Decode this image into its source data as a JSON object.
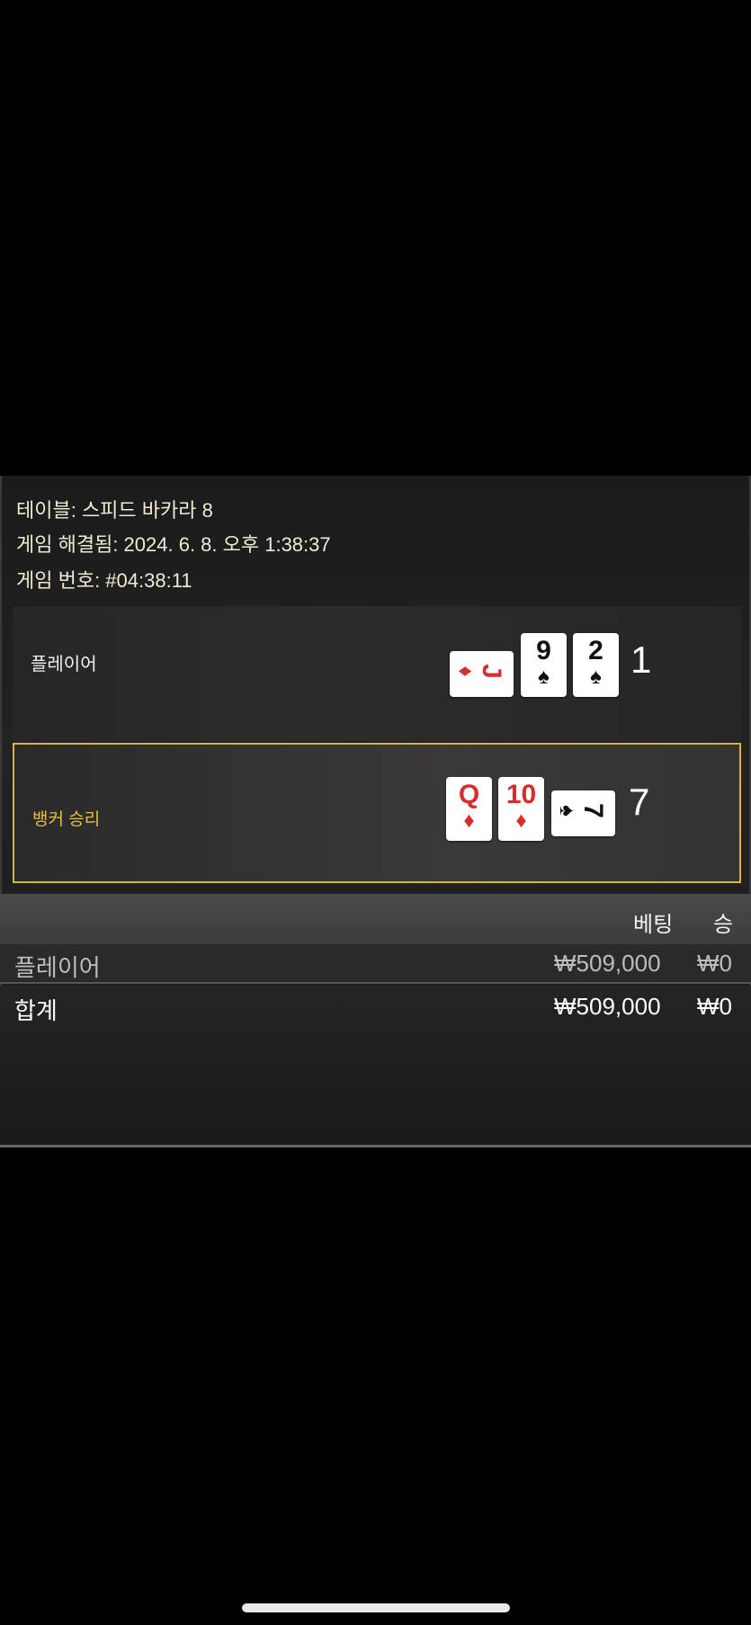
{
  "header": {
    "table": "테이블: 스피드 바카라 8",
    "resolved": "게임 해결됨: 2024. 6. 8. 오후 1:38:37",
    "game_no": "게임 번호: #04:38:11"
  },
  "player": {
    "label": "플레이어",
    "score": "1",
    "cards": [
      {
        "rank": "J",
        "suit": "♦",
        "color": "#d62d2d",
        "orientation": "horizontal"
      },
      {
        "rank": "9",
        "suit": "♠",
        "color": "#111111",
        "orientation": "vertical"
      },
      {
        "rank": "2",
        "suit": "♠",
        "color": "#111111",
        "orientation": "vertical"
      }
    ]
  },
  "banker": {
    "label": "뱅커 승리",
    "score": "7",
    "highlight_color": "#d9b531",
    "cards": [
      {
        "rank": "Q",
        "suit": "♦",
        "color": "#d62d2d",
        "orientation": "vertical"
      },
      {
        "rank": "10",
        "suit": "♦",
        "color": "#d62d2d",
        "orientation": "vertical"
      },
      {
        "rank": "7",
        "suit": "♠",
        "color": "#111111",
        "orientation": "horizontal"
      }
    ]
  },
  "table": {
    "columns": [
      "베팅",
      "승"
    ],
    "rows": [
      {
        "name": "플레이어",
        "bet": "₩509,000",
        "win": "₩0"
      }
    ],
    "total": {
      "name": "합계",
      "bet": "₩509,000",
      "win": "₩0"
    }
  }
}
